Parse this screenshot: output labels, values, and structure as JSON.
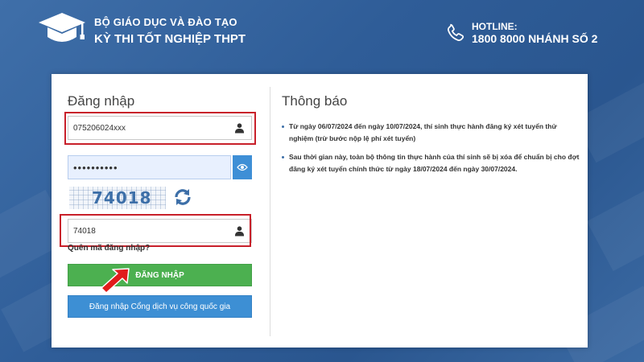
{
  "header": {
    "brand_top": "BỘ GIÁO DỤC VÀ ĐÀO TẠO",
    "brand_main": "KỲ THI TỐT NGHIỆP THPT",
    "hotline_label": "HOTLINE:",
    "hotline_number": "1800 8000 NHÁNH SỐ 2"
  },
  "login": {
    "title": "Đăng nhập",
    "username_value": "075206024xxx",
    "password_value": "••••••••••",
    "captcha_text": "74018",
    "captcha_input_value": "74018",
    "forgot_password": "Quên mã đăng nhập?",
    "login_button": "ĐĂNG NHẬP",
    "national_portal_button": "Đăng nhập Cổng dịch vụ công quốc gia"
  },
  "notice": {
    "title": "Thông báo",
    "items": [
      "Từ ngày 06/07/2024 đến ngày 10/07/2024, thí sinh thực hành đăng ký xét tuyển thử nghiệm (trừ bước nộp lệ phí xét tuyển)",
      "Sau thời gian này, toàn bộ thông tin thực hành của thí sinh sẽ bị xóa để chuẩn bị cho đợt đăng ký xét tuyển chính thức từ ngày 18/07/2024 đến ngày 30/07/2024."
    ]
  },
  "colors": {
    "background": "#2f5d98",
    "login_button": "#4cb050",
    "national_button": "#3d8fd4",
    "highlight": "#c8202a"
  },
  "icons": {
    "logo": "graduation-cap-icon",
    "phone": "phone-icon",
    "user": "user-icon",
    "eye": "eye-icon",
    "refresh": "refresh-icon",
    "arrow": "red-arrow-icon"
  }
}
